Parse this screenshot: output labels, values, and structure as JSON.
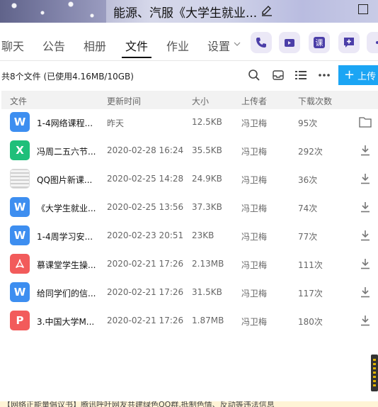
{
  "window": {
    "title": "能源、汽服《大学生就业...",
    "edit_icon": "pencil-icon"
  },
  "nav": {
    "tabs": [
      {
        "label": "聊天"
      },
      {
        "label": "公告"
      },
      {
        "label": "相册"
      },
      {
        "label": "文件",
        "active": true
      },
      {
        "label": "作业"
      },
      {
        "label": "设置"
      }
    ],
    "action_icons": [
      "phone-icon",
      "video-icon",
      "course-icon",
      "add-app-icon",
      "more-icon"
    ],
    "course_glyph": "课"
  },
  "toolbar": {
    "file_count": "共8个文件 (已使用4.16MB/10GB)",
    "upload_label": "上传"
  },
  "table": {
    "columns": [
      "文件",
      "更新时间",
      "大小",
      "上传者",
      "下载次数"
    ],
    "rows": [
      {
        "icon": "word",
        "glyph": "W",
        "name": "1-4网络课程...",
        "time": "昨天",
        "size": "12.5KB",
        "uploader": "冯卫梅",
        "downloads": "95次",
        "action": "folder"
      },
      {
        "icon": "excel",
        "glyph": "X",
        "name": "冯周二五六节...",
        "time": "2020-02-28 16:24",
        "size": "35.5KB",
        "uploader": "冯卫梅",
        "downloads": "292次",
        "action": "download"
      },
      {
        "icon": "image",
        "glyph": "",
        "name": "QQ图片新课...",
        "time": "2020-02-25 14:28",
        "size": "24.9KB",
        "uploader": "冯卫梅",
        "downloads": "36次",
        "action": "download"
      },
      {
        "icon": "word",
        "glyph": "W",
        "name": "《大学生就业...",
        "time": "2020-02-25 13:56",
        "size": "37.3KB",
        "uploader": "冯卫梅",
        "downloads": "74次",
        "action": "download"
      },
      {
        "icon": "word",
        "glyph": "W",
        "name": "1-4周学习安...",
        "time": "2020-02-23 20:51",
        "size": "23KB",
        "uploader": "冯卫梅",
        "downloads": "77次",
        "action": "download"
      },
      {
        "icon": "pdf",
        "glyph": "",
        "name": "慕课堂学生操...",
        "time": "2020-02-21 17:26",
        "size": "2.13MB",
        "uploader": "冯卫梅",
        "downloads": "111次",
        "action": "download"
      },
      {
        "icon": "word",
        "glyph": "W",
        "name": "给同学们的信...",
        "time": "2020-02-21 17:26",
        "size": "31.5KB",
        "uploader": "冯卫梅",
        "downloads": "117次",
        "action": "download"
      },
      {
        "icon": "ppt",
        "glyph": "P",
        "name": "3.中国大学M...",
        "time": "2020-02-21 17:26",
        "size": "1.87MB",
        "uploader": "冯卫梅",
        "downloads": "180次",
        "action": "download"
      }
    ]
  },
  "colors": {
    "word": "#3d8ef0",
    "excel": "#1fbf7a",
    "pdf": "#f25b5b",
    "ppt": "#f25b5b",
    "accent": "#1ba5f4"
  },
  "footer": {
    "text": "【网络正能量倡议书】腾讯呼吁网友共建绿色QQ群,抵制色情、反动等违法信息"
  }
}
